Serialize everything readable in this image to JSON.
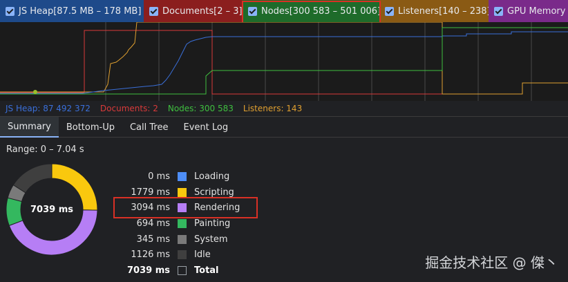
{
  "legend": {
    "items": [
      {
        "label": "JS Heap[87.5 MB – 178 MB]",
        "bg": "#1e4a8a"
      },
      {
        "label": "Documents[2 – 3]",
        "bg": "#8b1e1e"
      },
      {
        "label": "Nodes[300 583 – 501 006]",
        "bg": "#1e6b2a"
      },
      {
        "label": "Listeners[140 – 238]",
        "bg": "#8a5a14"
      },
      {
        "label": "GPU Memory",
        "bg": "#7a2a8a"
      }
    ]
  },
  "readout": {
    "js_heap": "JS Heap: 87 492 372",
    "documents": "Documents: 2",
    "nodes": "Nodes: 300 583",
    "listeners": "Listeners: 143"
  },
  "colors": {
    "js_heap": "#3a6fd9",
    "documents": "#d93a3a",
    "nodes": "#3fbf3f",
    "listeners": "#e0a030",
    "accent": "#8ab4f8"
  },
  "tabs": [
    {
      "label": "Summary",
      "active": true
    },
    {
      "label": "Bottom-Up",
      "active": false
    },
    {
      "label": "Call Tree",
      "active": false
    },
    {
      "label": "Event Log",
      "active": false
    }
  ],
  "summary": {
    "range": "Range: 0 – 7.04 s",
    "total_label": "7039 ms",
    "rows": [
      {
        "value": "0 ms",
        "label": "Loading",
        "color": "#4e8ef7",
        "ms": 0
      },
      {
        "value": "1779 ms",
        "label": "Scripting",
        "color": "#f9c80e",
        "ms": 1779
      },
      {
        "value": "3094 ms",
        "label": "Rendering",
        "color": "#b67ef5",
        "ms": 3094
      },
      {
        "value": "694 ms",
        "label": "Painting",
        "color": "#34b85f",
        "ms": 694
      },
      {
        "value": "345 ms",
        "label": "System",
        "color": "#7a7a7a",
        "ms": 345
      },
      {
        "value": "1126 ms",
        "label": "Idle",
        "color": "#3f3f3f",
        "ms": 1126
      },
      {
        "value": "7039 ms",
        "label": "Total",
        "color": "#202124",
        "ms": 7039
      }
    ]
  },
  "watermark": "掘金技术社区 @ 傑丶"
}
